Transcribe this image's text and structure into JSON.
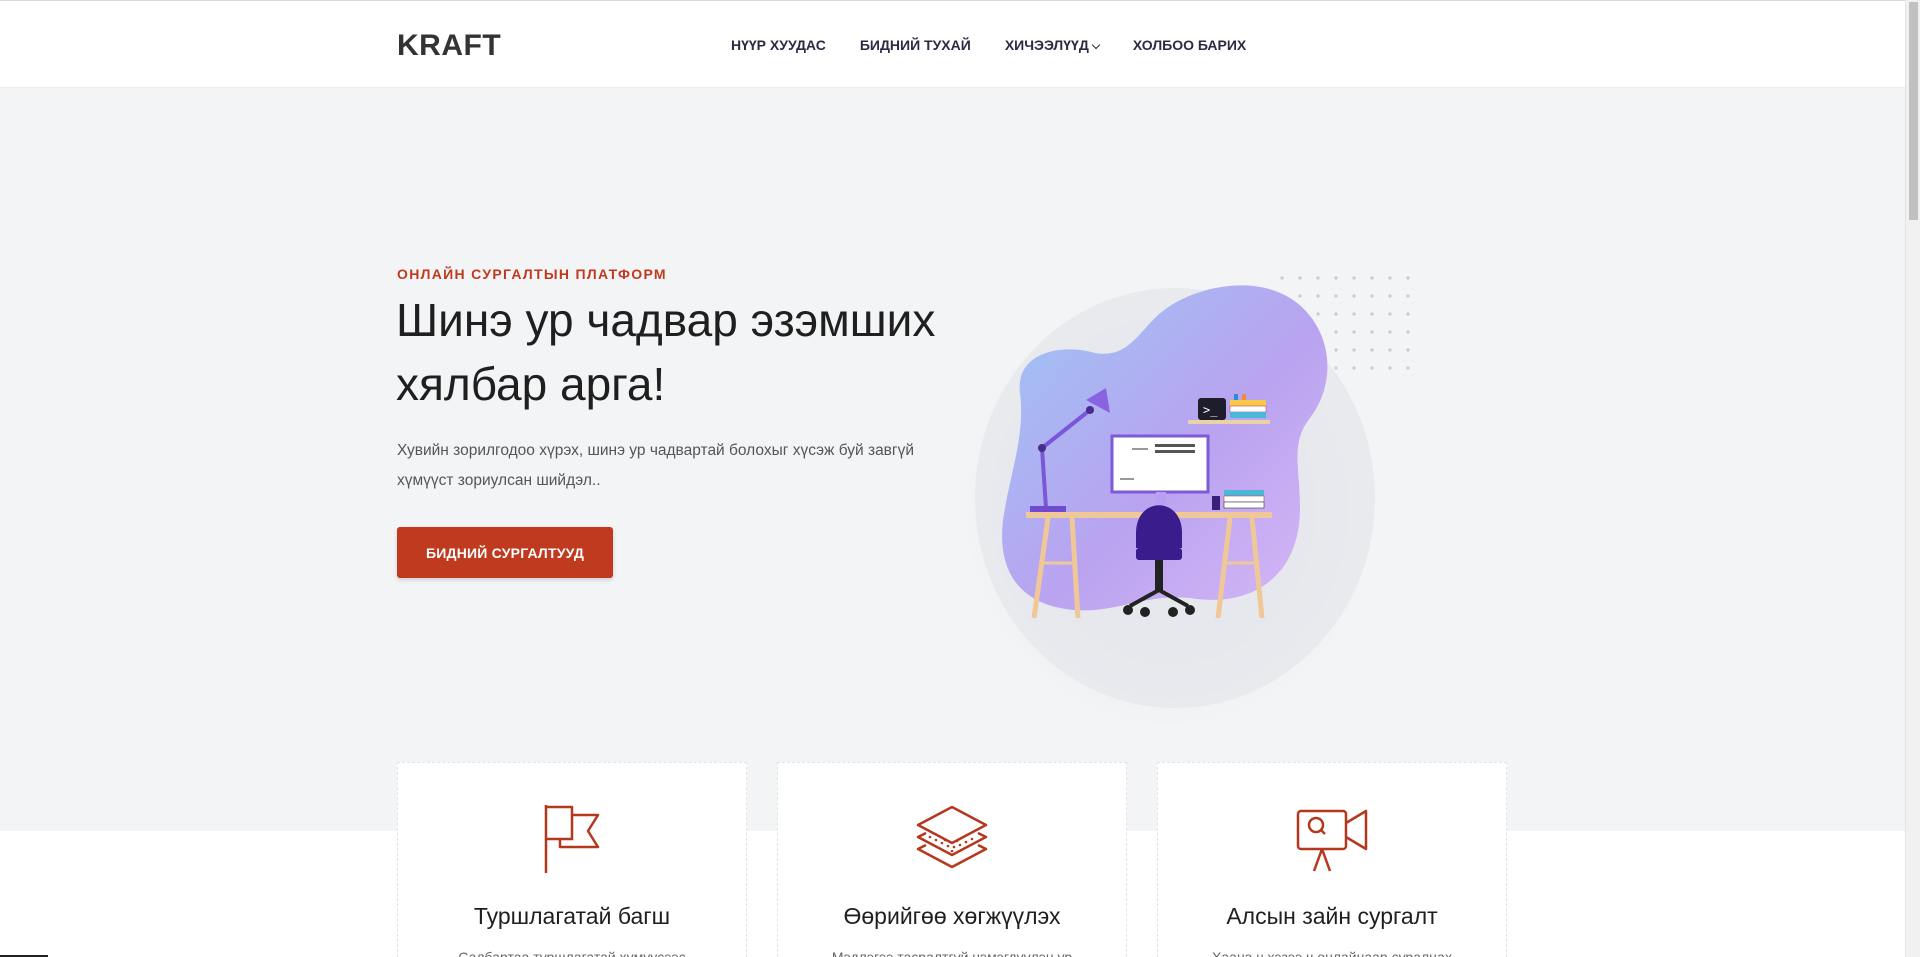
{
  "header": {
    "logo": "KRAFT",
    "nav": [
      {
        "label": "НҮҮР ХУУДАС"
      },
      {
        "label": "БИДНИЙ ТУХАЙ"
      },
      {
        "label": "ХИЧЭЭЛҮҮД",
        "has_dropdown": true
      },
      {
        "label": "ХОЛБОО БАРИХ"
      }
    ]
  },
  "hero": {
    "eyebrow": "ОНЛАЙН СУРГАЛТЫН ПЛАТФОРМ",
    "title_line1": "Шинэ ур чадвар эзэмших",
    "title_line2": "хялбар арга!",
    "text_line1": "Хувийн зорилгодоо хүрэх, шинэ ур чадвартай болохыг хүсэж буй завгүй",
    "text_line2": "хүмүүст зориулсан шийдэл..",
    "cta_label": "БИДНИЙ СУРГАЛТУУД",
    "accent_color": "#bf3a1f"
  },
  "features": [
    {
      "icon": "flag-icon",
      "title": "Туршлагатай багш",
      "desc": "Салбартаа туршлагатай хүмүүсээс"
    },
    {
      "icon": "layers-icon",
      "title": "Өөрийгөө хөгжүүлэх",
      "desc": "Мэдлэгээ тасралтгүй нэмэгдүүлэн ур"
    },
    {
      "icon": "video-camera-icon",
      "title": "Алсын зайн сургалт",
      "desc": "Хаана ч хэзээ ч онлайнаар суралцах"
    }
  ]
}
